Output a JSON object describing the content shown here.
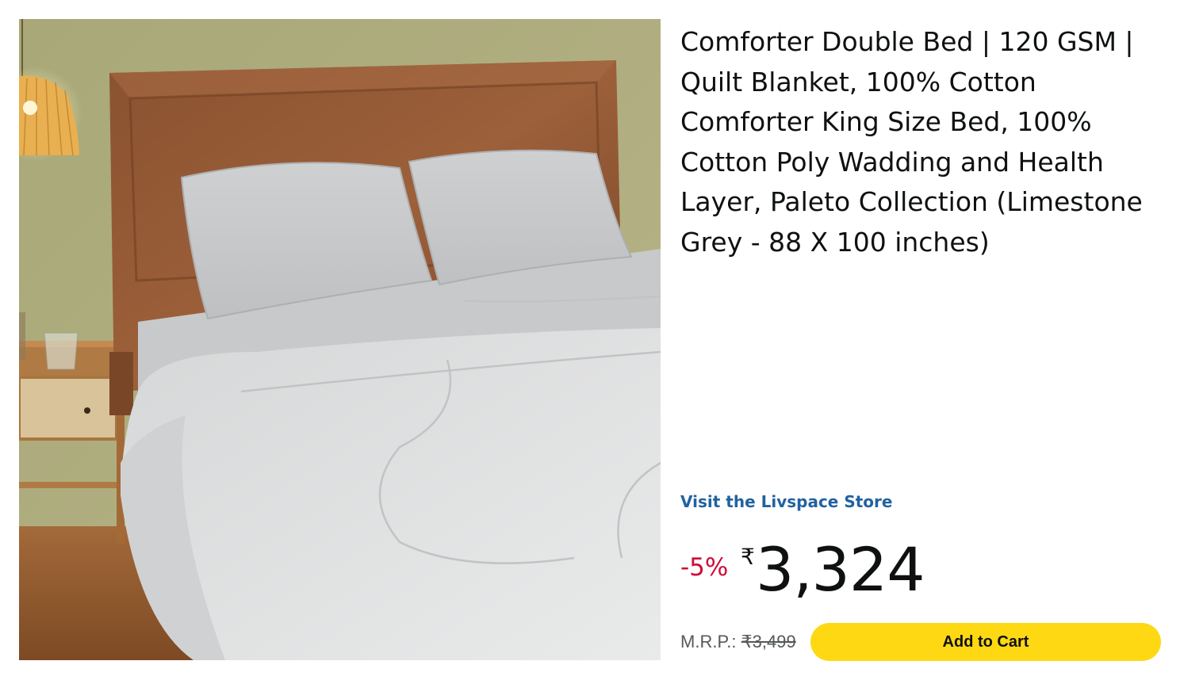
{
  "product": {
    "title": "Comforter Double Bed | 120 GSM | Quilt Blanket, 100% Cotton Comforter King Size Bed, 100% Cotton Poly Wadding and Health Layer, Paleto Collection (Limestone Grey - 88 X 100 inches)",
    "store_link": "Visit the Livspace Store",
    "discount": "-5%",
    "currency": "₹",
    "price": "3,324",
    "mrp_label": "M.R.P.:",
    "mrp_value": "₹3,499",
    "add_to_cart": "Add to Cart"
  },
  "colors": {
    "price_discount": "#cc0c39",
    "link": "#2162a1",
    "button": "#ffd814"
  }
}
